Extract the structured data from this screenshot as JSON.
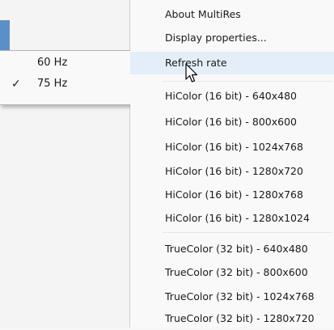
{
  "refresh_submenu": {
    "items": [
      {
        "label": "60 Hz",
        "checked": false
      },
      {
        "label": "75 Hz",
        "checked": true
      }
    ],
    "check_glyph": "✓"
  },
  "context_menu": {
    "items": [
      {
        "label": "About MultiRes"
      },
      {
        "label": "Display properties..."
      },
      {
        "label": "Refresh rate",
        "hovered": true
      },
      {
        "label": "HiColor (16 bit) - 640x480"
      },
      {
        "label": "HiColor (16 bit) - 800x600"
      },
      {
        "label": "HiColor (16 bit) - 1024x768"
      },
      {
        "label": "HiColor (16 bit) - 1280x720"
      },
      {
        "label": "HiColor (16 bit) - 1280x768"
      },
      {
        "label": "HiColor (16 bit) - 1280x1024"
      },
      {
        "label": "TrueColor (32 bit) - 640x480"
      },
      {
        "label": "TrueColor (32 bit) - 800x600"
      },
      {
        "label": "TrueColor (32 bit) - 1024x768"
      },
      {
        "label": "TrueColor (32 bit) - 1280x720"
      }
    ]
  },
  "colors": {
    "accent": "#5b8fc8",
    "hover": "#e3eef9"
  },
  "icons": {
    "cursor": "mouse-pointer-icon",
    "check": "checkmark-icon"
  }
}
